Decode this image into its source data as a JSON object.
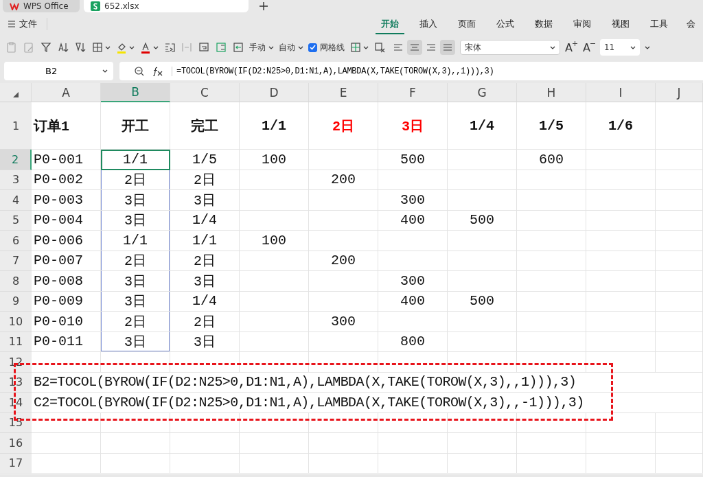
{
  "window_tabs": [
    {
      "label": "WPS Office",
      "selected": false,
      "kind": "home"
    },
    {
      "label": "652.xlsx",
      "selected": true,
      "kind": "sheet"
    }
  ],
  "menu": {
    "file": "文件",
    "tabs": [
      {
        "label": "开始",
        "selected": true
      },
      {
        "label": "插入",
        "selected": false
      },
      {
        "label": "页面",
        "selected": false
      },
      {
        "label": "公式",
        "selected": false
      },
      {
        "label": "数据",
        "selected": false
      },
      {
        "label": "审阅",
        "selected": false
      },
      {
        "label": "视图",
        "selected": false
      },
      {
        "label": "工具",
        "selected": false
      },
      {
        "label": "会",
        "selected": false
      }
    ]
  },
  "toolbar": {
    "row_height": "手动",
    "col_width": "自动",
    "gridlines": {
      "label": "网格线",
      "checked": true
    },
    "alignment": [
      {
        "kind": "left",
        "selected": false
      },
      {
        "kind": "center",
        "selected": true
      },
      {
        "kind": "right",
        "selected": false
      },
      {
        "kind": "justify",
        "selected": true
      }
    ],
    "font": "宋体",
    "grow_font": "A",
    "shrink_font": "A",
    "font_size": "11"
  },
  "formula_bar": {
    "name_box": "B2",
    "formula": "=TOCOL(BYROW(IF(D2:N25>0,D1:N1,A),LAMBDA(X,TAKE(TOROW(X,3),,1))),3)"
  },
  "sheet": {
    "columns": [
      {
        "label": "A",
        "selected": false
      },
      {
        "label": "B",
        "selected": true
      },
      {
        "label": "C",
        "selected": false
      },
      {
        "label": "D",
        "selected": false
      },
      {
        "label": "E",
        "selected": false
      },
      {
        "label": "F",
        "selected": false
      },
      {
        "label": "G",
        "selected": false
      },
      {
        "label": "H",
        "selected": false
      },
      {
        "label": "I",
        "selected": false
      },
      {
        "label": "J",
        "selected": false
      }
    ],
    "rows": [
      {
        "header": "1",
        "selected": false,
        "kind": "title",
        "cells": [
          "订单1",
          "开工",
          "完工",
          "1/1",
          {
            "text": "2日",
            "color": "#ff0000"
          },
          {
            "text": "3日",
            "color": "#ff0000"
          },
          "1/4",
          "1/5",
          "1/6",
          ""
        ]
      },
      {
        "header": "2",
        "selected": true,
        "kind": "data",
        "cells": [
          "P0-001",
          {
            "text": "1/1",
            "active": true
          },
          "1/5",
          "100",
          "",
          "500",
          "",
          "600",
          "",
          ""
        ]
      },
      {
        "header": "3",
        "selected": false,
        "kind": "data",
        "cells": [
          "P0-002",
          {
            "text": "2日",
            "active": false
          },
          "2日",
          "",
          "200",
          "",
          "",
          "",
          "",
          ""
        ]
      },
      {
        "header": "4",
        "selected": false,
        "kind": "data",
        "cells": [
          "P0-003",
          {
            "text": "3日",
            "active": false
          },
          "3日",
          "",
          "",
          "300",
          "",
          "",
          "",
          ""
        ]
      },
      {
        "header": "5",
        "selected": false,
        "kind": "data",
        "cells": [
          "P0-004",
          {
            "text": "3日",
            "active": false
          },
          "1/4",
          "",
          "",
          "400",
          "500",
          "",
          "",
          ""
        ]
      },
      {
        "header": "6",
        "selected": false,
        "kind": "data",
        "cells": [
          "P0-006",
          {
            "text": "1/1",
            "active": false
          },
          "1/1",
          "100",
          "",
          "",
          "",
          "",
          "",
          ""
        ]
      },
      {
        "header": "7",
        "selected": false,
        "kind": "data",
        "cells": [
          "P0-007",
          {
            "text": "2日",
            "active": false
          },
          "2日",
          "",
          "200",
          "",
          "",
          "",
          "",
          ""
        ]
      },
      {
        "header": "8",
        "selected": false,
        "kind": "data",
        "cells": [
          "P0-008",
          {
            "text": "3日",
            "active": false
          },
          "3日",
          "",
          "",
          "300",
          "",
          "",
          "",
          ""
        ]
      },
      {
        "header": "9",
        "selected": false,
        "kind": "data",
        "cells": [
          "P0-009",
          {
            "text": "3日",
            "active": false
          },
          "1/4",
          "",
          "",
          "400",
          "500",
          "",
          "",
          ""
        ]
      },
      {
        "header": "10",
        "selected": false,
        "kind": "data",
        "cells": [
          "P0-010",
          {
            "text": "2日",
            "active": false
          },
          "2日",
          "",
          "300",
          "",
          "",
          "",
          "",
          ""
        ]
      },
      {
        "header": "11",
        "selected": false,
        "kind": "data",
        "cells": [
          "P0-011",
          {
            "text": "3日",
            "active": false
          },
          "3日",
          "",
          "",
          "800",
          "",
          "",
          "",
          ""
        ]
      },
      {
        "header": "12",
        "selected": false,
        "kind": "data",
        "cells": [
          "",
          "",
          "",
          "",
          "",
          "",
          "",
          "",
          "",
          ""
        ]
      },
      {
        "header": "13",
        "selected": false,
        "kind": "note",
        "text": "B2=TOCOL(BYROW(IF(D2:N25>0,D1:N1,A),LAMBDA(X,TAKE(TOROW(X,3),,1))),3)"
      },
      {
        "header": "14",
        "selected": false,
        "kind": "note",
        "text": "C2=TOCOL(BYROW(IF(D2:N25>0,D1:N1,A),LAMBDA(X,TAKE(TOROW(X,3),,-1))),3)"
      },
      {
        "header": "15",
        "selected": false,
        "kind": "data",
        "cells": [
          "",
          "",
          "",
          "",
          "",
          "",
          "",
          "",
          "",
          ""
        ]
      },
      {
        "header": "16",
        "selected": false,
        "kind": "data",
        "cells": [
          "",
          "",
          "",
          "",
          "",
          "",
          "",
          "",
          "",
          ""
        ]
      },
      {
        "header": "17",
        "selected": false,
        "kind": "data",
        "cells": [
          "",
          "",
          "",
          "",
          "",
          "",
          "",
          "",
          "",
          ""
        ]
      }
    ]
  }
}
